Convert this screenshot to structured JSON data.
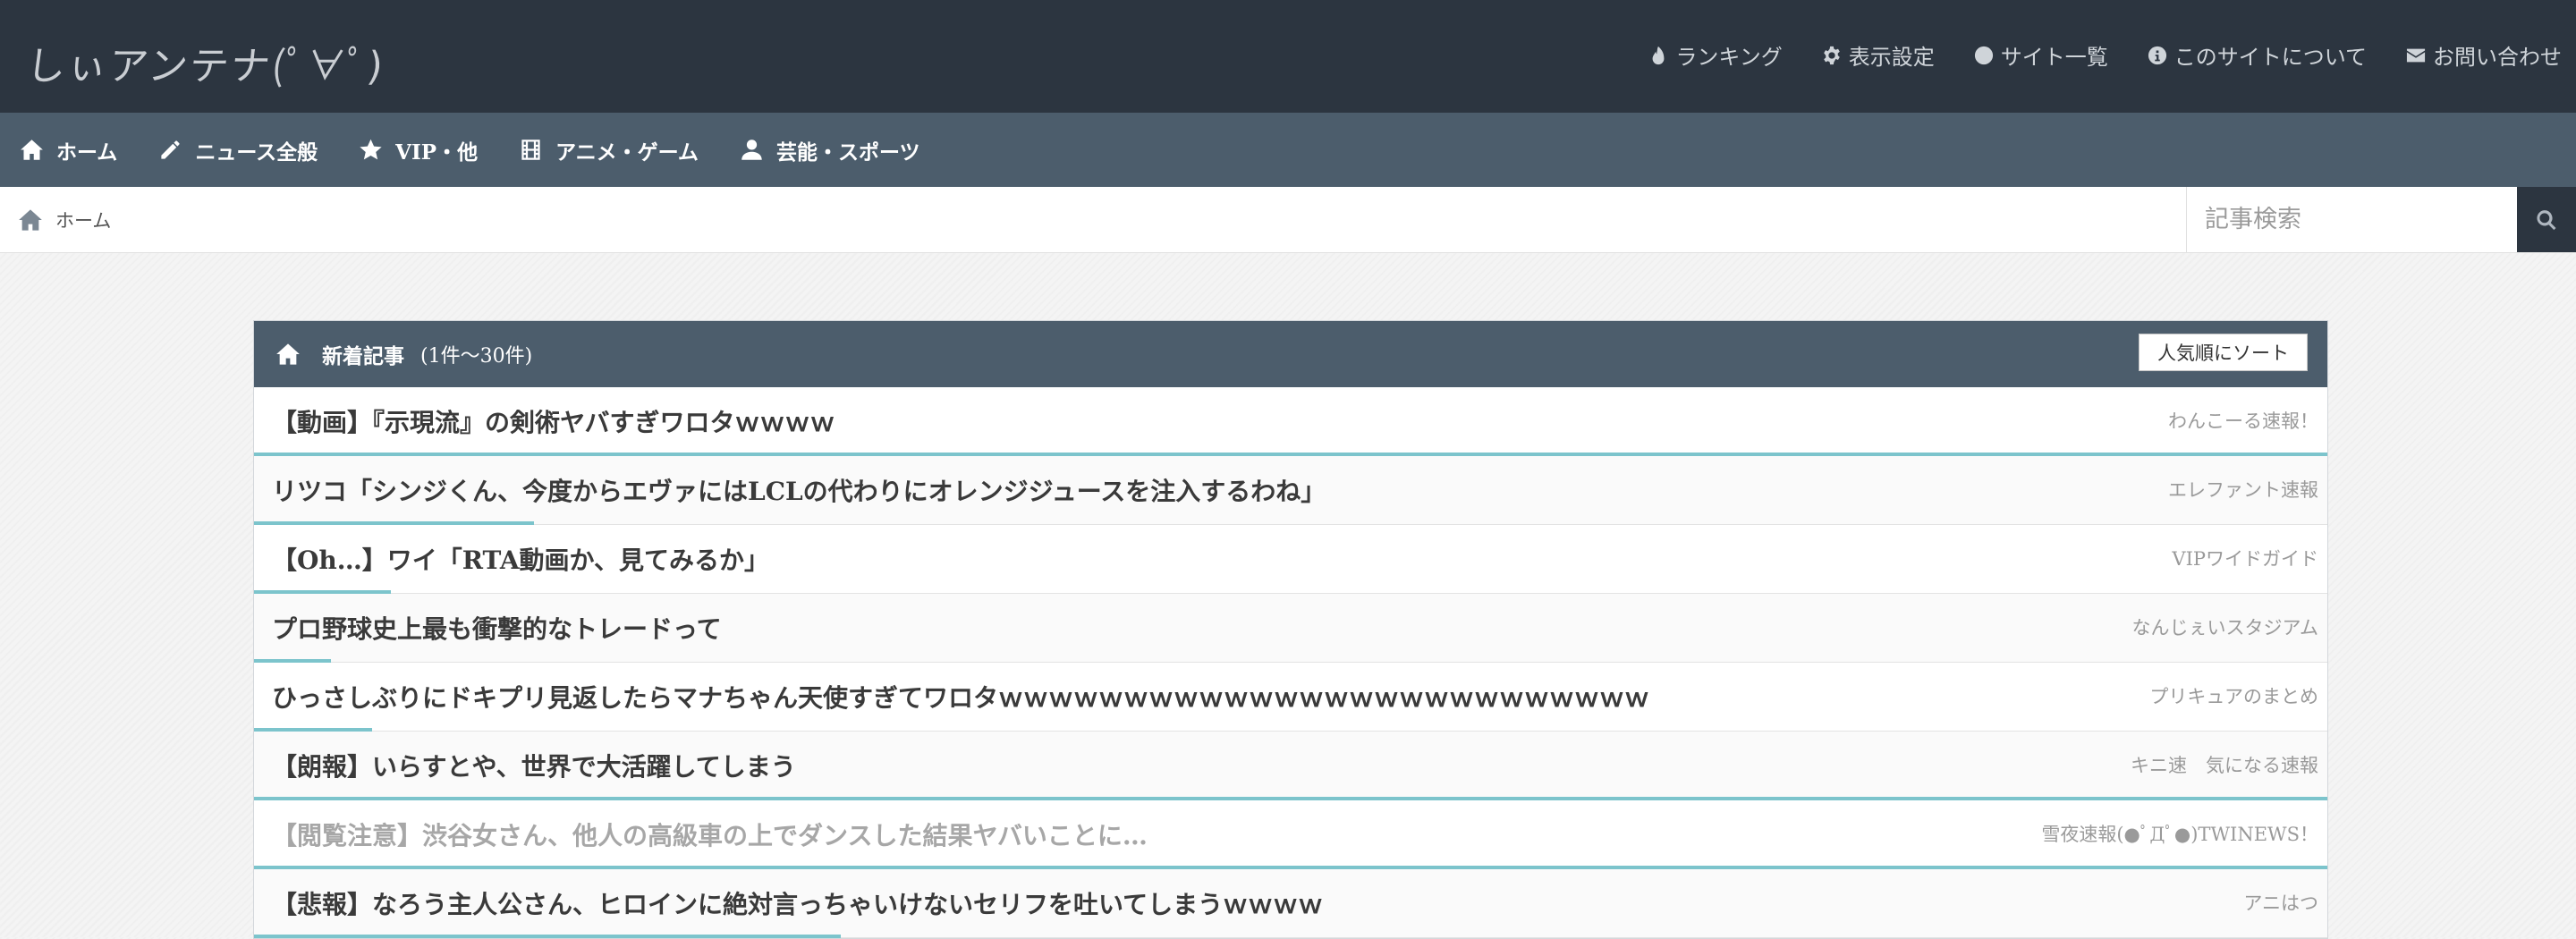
{
  "site": {
    "logo_text": "しぃアンテナ(ﾟ∀ﾟ)",
    "top_nav": [
      {
        "label": "ランキング",
        "icon": "fire-icon"
      },
      {
        "label": "表示設定",
        "icon": "gear-icon"
      },
      {
        "label": "サイト一覧",
        "icon": "globe-icon"
      },
      {
        "label": "このサイトについて",
        "icon": "info-icon"
      },
      {
        "label": "お問い合わせ",
        "icon": "mail-icon"
      }
    ]
  },
  "categories": [
    {
      "label": "ホーム",
      "icon": "home-icon"
    },
    {
      "label": "ニュース全般",
      "icon": "pencil-icon"
    },
    {
      "label": "VIP・他",
      "icon": "star-icon"
    },
    {
      "label": "アニメ・ゲーム",
      "icon": "film-icon"
    },
    {
      "label": "芸能・スポーツ",
      "icon": "user-icon"
    }
  ],
  "breadcrumb": {
    "label": "ホーム",
    "icon": "home-icon"
  },
  "search": {
    "placeholder": "記事検索",
    "button_icon": "search-icon"
  },
  "panel": {
    "title": "新着記事",
    "range": "(1件〜30件)",
    "sort_label": "人気順にソート"
  },
  "articles": [
    {
      "title": "【動画】『示現流』の剣術ヤバすぎワロタｗｗｗｗ",
      "site": "わんこーる速報！",
      "popularity": 1.0,
      "visited": false
    },
    {
      "title": "リツコ「シンジくん、今度からエヴァにはLCLの代わりにオレンジジュースを注入するわね」",
      "site": "エレファント速報",
      "popularity": 0.135,
      "visited": false
    },
    {
      "title": "【Oh…】ワイ「RTA動画か、見てみるか」",
      "site": "VIPワイドガイド",
      "popularity": 0.066,
      "visited": false
    },
    {
      "title": "プロ野球史上最も衝撃的なトレードって",
      "site": "なんじぇいスタジアム",
      "popularity": 0.037,
      "visited": false
    },
    {
      "title": "ひっさしぶりにドキプリ見返したらマナちゃん天使すぎてワロタｗｗｗｗｗｗｗｗｗｗｗｗｗｗｗｗｗｗｗｗｗｗｗｗｗｗ",
      "site": "プリキュアのまとめ",
      "popularity": 0.057,
      "visited": false
    },
    {
      "title": "【朗報】いらすとや、世界で大活躍してしまう",
      "site": "キニ速　気になる速報",
      "popularity": 1.0,
      "visited": false
    },
    {
      "title": "【閲覧注意】渋谷女さん、他人の高級車の上でダンスした結果ヤバいことに…",
      "site": "雪夜速報(●ﾟДﾟ●)TWINEWS！",
      "popularity": 1.0,
      "visited": true
    },
    {
      "title": "【悲報】なろう主人公さん、ヒロインに絶対言っちゃいけないセリフを吐いてしまうｗｗｗｗ",
      "site": "アニはつ",
      "popularity": 0.283,
      "visited": false
    }
  ]
}
